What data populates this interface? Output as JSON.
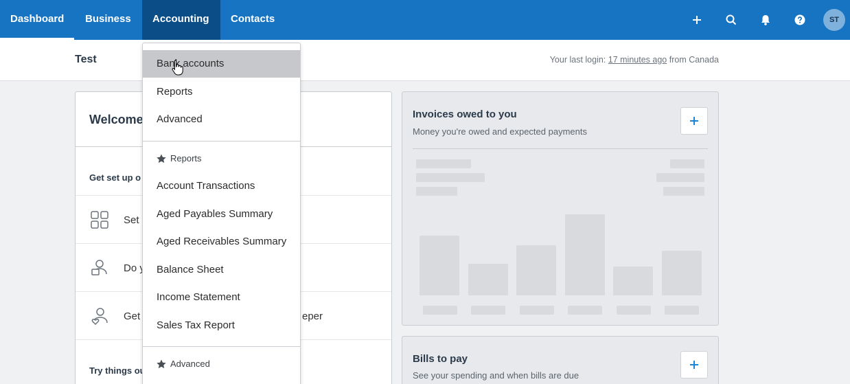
{
  "nav": {
    "items": [
      "Dashboard",
      "Business",
      "Accounting",
      "Contacts"
    ],
    "avatar_initials": "ST",
    "icons": [
      "plus-icon",
      "search-icon",
      "bell-icon",
      "help-icon"
    ],
    "accent_color": "#1674c2",
    "open_item_color": "#0b4d86"
  },
  "header": {
    "org_name": "Test",
    "last_login_prefix": "Your last login:",
    "last_login_link": "17 minutes ago",
    "last_login_suffix": "from Canada"
  },
  "welcome": {
    "title": "Welcome",
    "setup_heading": "Get set up o",
    "rows": [
      {
        "icon": "grid-icon",
        "text": "Set"
      },
      {
        "icon": "user-card-icon",
        "text": "Do y"
      },
      {
        "icon": "user-heart-icon",
        "text": "Get",
        "suffix": "eper"
      }
    ],
    "try_heading": "Try things ou"
  },
  "invoices_card": {
    "title": "Invoices owed to you",
    "subtitle": "Money you're owed and expected payments",
    "placeholder_bars": [
      0.74,
      0.39,
      0.62,
      1.0,
      0.36,
      0.55
    ]
  },
  "bills_card": {
    "title": "Bills to pay",
    "subtitle": "See your spending and when bills are due"
  },
  "dropdown": {
    "items": [
      "Bank accounts",
      "Reports",
      "Advanced"
    ],
    "reports_section": "Reports",
    "report_items": [
      "Account Transactions",
      "Aged Payables Summary",
      "Aged Receivables Summary",
      "Balance Sheet",
      "Income Statement",
      "Sales Tax Report"
    ],
    "advanced_section": "Advanced"
  }
}
